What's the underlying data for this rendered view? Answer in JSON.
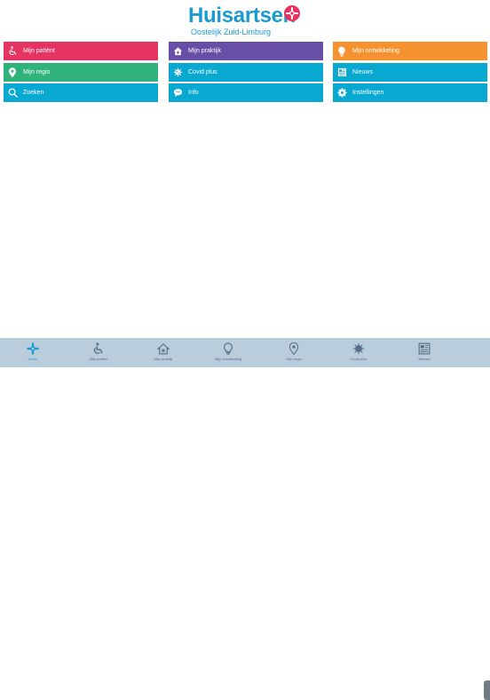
{
  "logo": {
    "word": "Huisartsen",
    "subtitle": "Oostelijk Zuid-Limburg",
    "text_color": "#1a9bcf",
    "badge_color": "#e63462"
  },
  "colors": {
    "red": "#e63462",
    "green": "#2fb37a",
    "blue": "#08a8d1",
    "purple": "#684ea6",
    "orange": "#f5922f",
    "tabbar": "#b9cddd"
  },
  "tiles": [
    {
      "label": "Mijn patiënt",
      "icon": "wheelchair-icon",
      "color": "#e63462"
    },
    {
      "label": "Mijn regio",
      "icon": "location-pin-icon",
      "color": "#2fb37a"
    },
    {
      "label": "Zoeken",
      "icon": "search-icon",
      "color": "#08a8d1"
    },
    {
      "label": "Mijn praktijk",
      "icon": "house-icon",
      "color": "#684ea6"
    },
    {
      "label": "Covid plus",
      "icon": "virus-icon",
      "color": "#08a8d1"
    },
    {
      "label": "Info",
      "icon": "chat-bubble-icon",
      "color": "#08a8d1"
    },
    {
      "label": "Mijn ontwikkeling",
      "icon": "lightbulb-icon",
      "color": "#f5922f"
    },
    {
      "label": "Nieuws",
      "icon": "newspaper-icon",
      "color": "#08a8d1"
    },
    {
      "label": "Instellingen",
      "icon": "gear-icon",
      "color": "#08a8d1"
    }
  ],
  "tabbar": {
    "tabs": [
      {
        "label": "Home",
        "icon": "home-cross-icon"
      },
      {
        "label": "Mijn patiënt",
        "icon": "wheelchair-icon"
      },
      {
        "label": "Mijn praktijk",
        "icon": "house-icon"
      },
      {
        "label": "Mijn ontwikkeling",
        "icon": "lightbulb-icon"
      },
      {
        "label": "Mijn regio",
        "icon": "location-pin-icon"
      },
      {
        "label": "Covid plus",
        "icon": "virus-icon"
      },
      {
        "label": "Nieuws",
        "icon": "newspaper-icon"
      }
    ]
  }
}
